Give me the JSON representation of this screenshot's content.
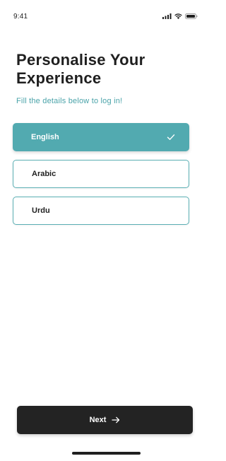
{
  "status_bar": {
    "time": "9:41",
    "icons": [
      "signal-icon",
      "wifi-icon",
      "battery-icon"
    ]
  },
  "header": {
    "title": "Personalise Your Experience",
    "subtitle": "Fill the details below to log in!"
  },
  "language_options": [
    {
      "label": "English",
      "selected": true,
      "icon": "check-icon"
    },
    {
      "label": "Arabic",
      "selected": false
    },
    {
      "label": "Urdu",
      "selected": false
    }
  ],
  "footer": {
    "next_label": "Next",
    "next_icon": "arrow-right-icon"
  },
  "colors": {
    "accent": "#52aab0",
    "subtitle": "#4aa3a9",
    "button_bg": "#232323",
    "text": "#1f1f1f"
  }
}
